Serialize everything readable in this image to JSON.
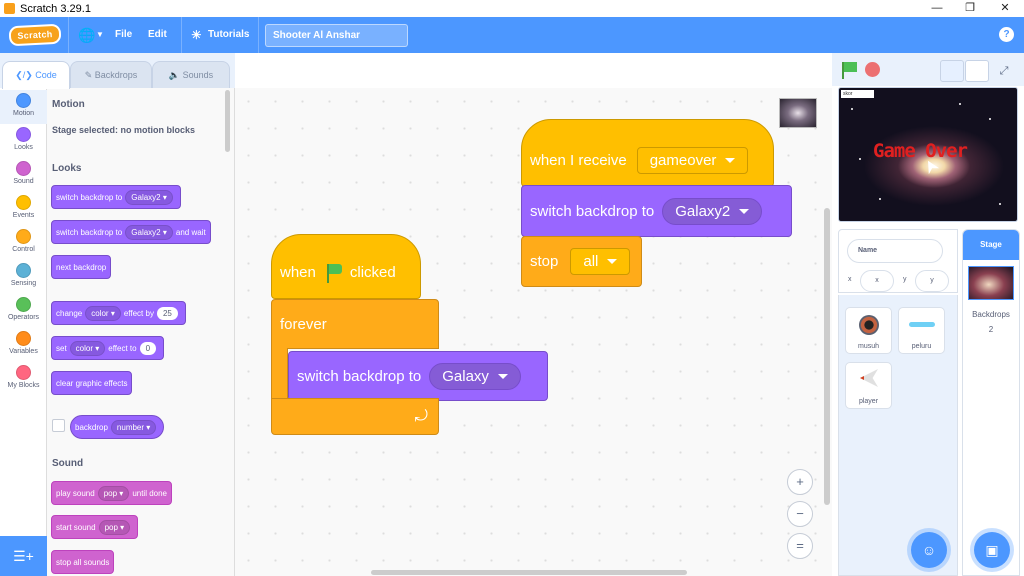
{
  "window": {
    "title": "Scratch 3.29.1",
    "minimize": "—",
    "restore": "❐",
    "close": "✕"
  },
  "menu": {
    "logo": "Scratch",
    "file": "File",
    "edit": "Edit",
    "tutorials": "Tutorials",
    "project_title": "Shooter Al Anshar",
    "globe_icon": "globe-icon",
    "help": "?"
  },
  "tabs": {
    "code": "Code",
    "backdrops": "Backdrops",
    "sounds": "Sounds"
  },
  "categories": [
    {
      "label": "Motion",
      "color": "#4c97ff"
    },
    {
      "label": "Looks",
      "color": "#9966ff"
    },
    {
      "label": "Sound",
      "color": "#cf63cf"
    },
    {
      "label": "Events",
      "color": "#ffbf00"
    },
    {
      "label": "Control",
      "color": "#ffab19"
    },
    {
      "label": "Sensing",
      "color": "#5cb1d6"
    },
    {
      "label": "Operators",
      "color": "#59c059"
    },
    {
      "label": "Variables",
      "color": "#ff8c1a"
    },
    {
      "label": "My Blocks",
      "color": "#ff6680"
    }
  ],
  "palette": {
    "motion_heading": "Motion",
    "motion_note": "Stage selected: no motion blocks",
    "looks_heading": "Looks",
    "switch_backdrop": "switch backdrop to",
    "switch_backdrop_val": "Galaxy2",
    "switch_backdrop_wait": "switch backdrop to",
    "switch_backdrop_wait_val": "Galaxy2",
    "and_wait": "and wait",
    "next_backdrop": "next backdrop",
    "change": "change",
    "change_effect": "color",
    "effect_by": "effect by",
    "change_value": "25",
    "set": "set",
    "set_effect": "color",
    "effect_to": "effect to",
    "set_value": "0",
    "clear_effects": "clear graphic effects",
    "backdrop": "backdrop",
    "backdrop_val": "number",
    "sound_heading": "Sound",
    "play_sound": "play sound",
    "play_sound_val": "pop",
    "until_done": "until done",
    "start_sound": "start sound",
    "start_sound_val": "pop",
    "stop_all_sounds": "stop all sounds"
  },
  "scripts": {
    "when": "when",
    "clicked": "clicked",
    "forever": "forever",
    "switch_backdrop": "switch backdrop to",
    "backdrop_galaxy": "Galaxy",
    "when_i_receive": "when I receive",
    "message": "gameover",
    "switch_backdrop2": "switch backdrop to",
    "backdrop_galaxy2": "Galaxy2",
    "stop": "stop",
    "stop_option": "all"
  },
  "zoom": {
    "in": "+",
    "out": "−",
    "reset": "="
  },
  "stage": {
    "game_over_text": "Game Over",
    "tag": "skor"
  },
  "sprite_info": {
    "name_placeholder": "Name",
    "x_label": "x",
    "x_value": "x",
    "y_label": "y",
    "y_value": "y"
  },
  "sprites": [
    {
      "name": "musuh"
    },
    {
      "name": "peluru"
    },
    {
      "name": "player"
    }
  ],
  "stage_pane": {
    "tab": "Stage",
    "backdrops_label": "Backdrops",
    "backdrops_count": "2"
  }
}
